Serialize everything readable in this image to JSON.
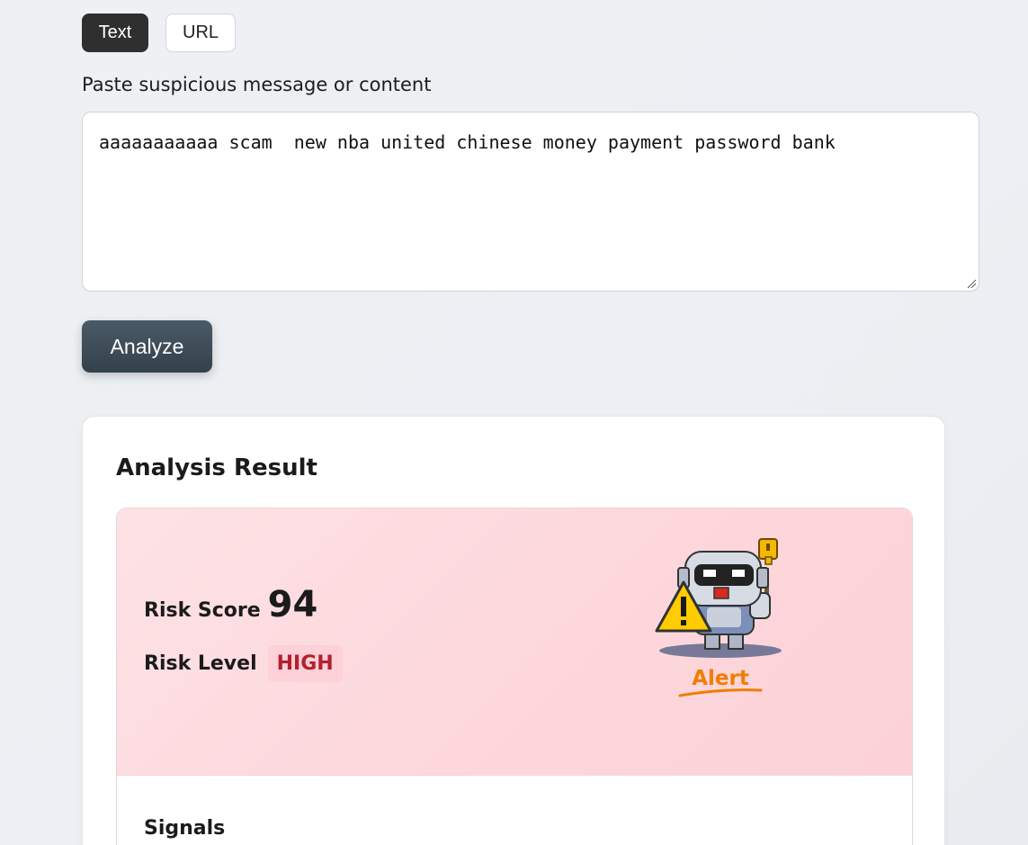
{
  "input_mode_tabs": [
    {
      "label": "Text",
      "active": true
    },
    {
      "label": "URL",
      "active": false
    }
  ],
  "input": {
    "label": "Paste suspicious message or content",
    "value": "aaaaaaaaaaa scam  new nba united chinese money payment password bank"
  },
  "analyze_button": {
    "label": "Analyze"
  },
  "result": {
    "title": "Analysis Result",
    "risk_score_label": "Risk Score",
    "risk_score": "94",
    "risk_level_label": "Risk Level",
    "risk_level": "HIGH",
    "mascot_caption": "Alert",
    "signals_title": "Signals"
  },
  "colors": {
    "tab_active_bg": "#2f2f2f",
    "analyze_bg": "#3b4953",
    "risk_panel_bg": "#fdd9de",
    "risk_level_text": "#b3202c",
    "alert_orange": "#f07d00"
  },
  "icons": {
    "mascot": "robot-warning-mascot-icon",
    "warning": "warning-triangle-icon",
    "resize": "resize-grip-icon"
  }
}
